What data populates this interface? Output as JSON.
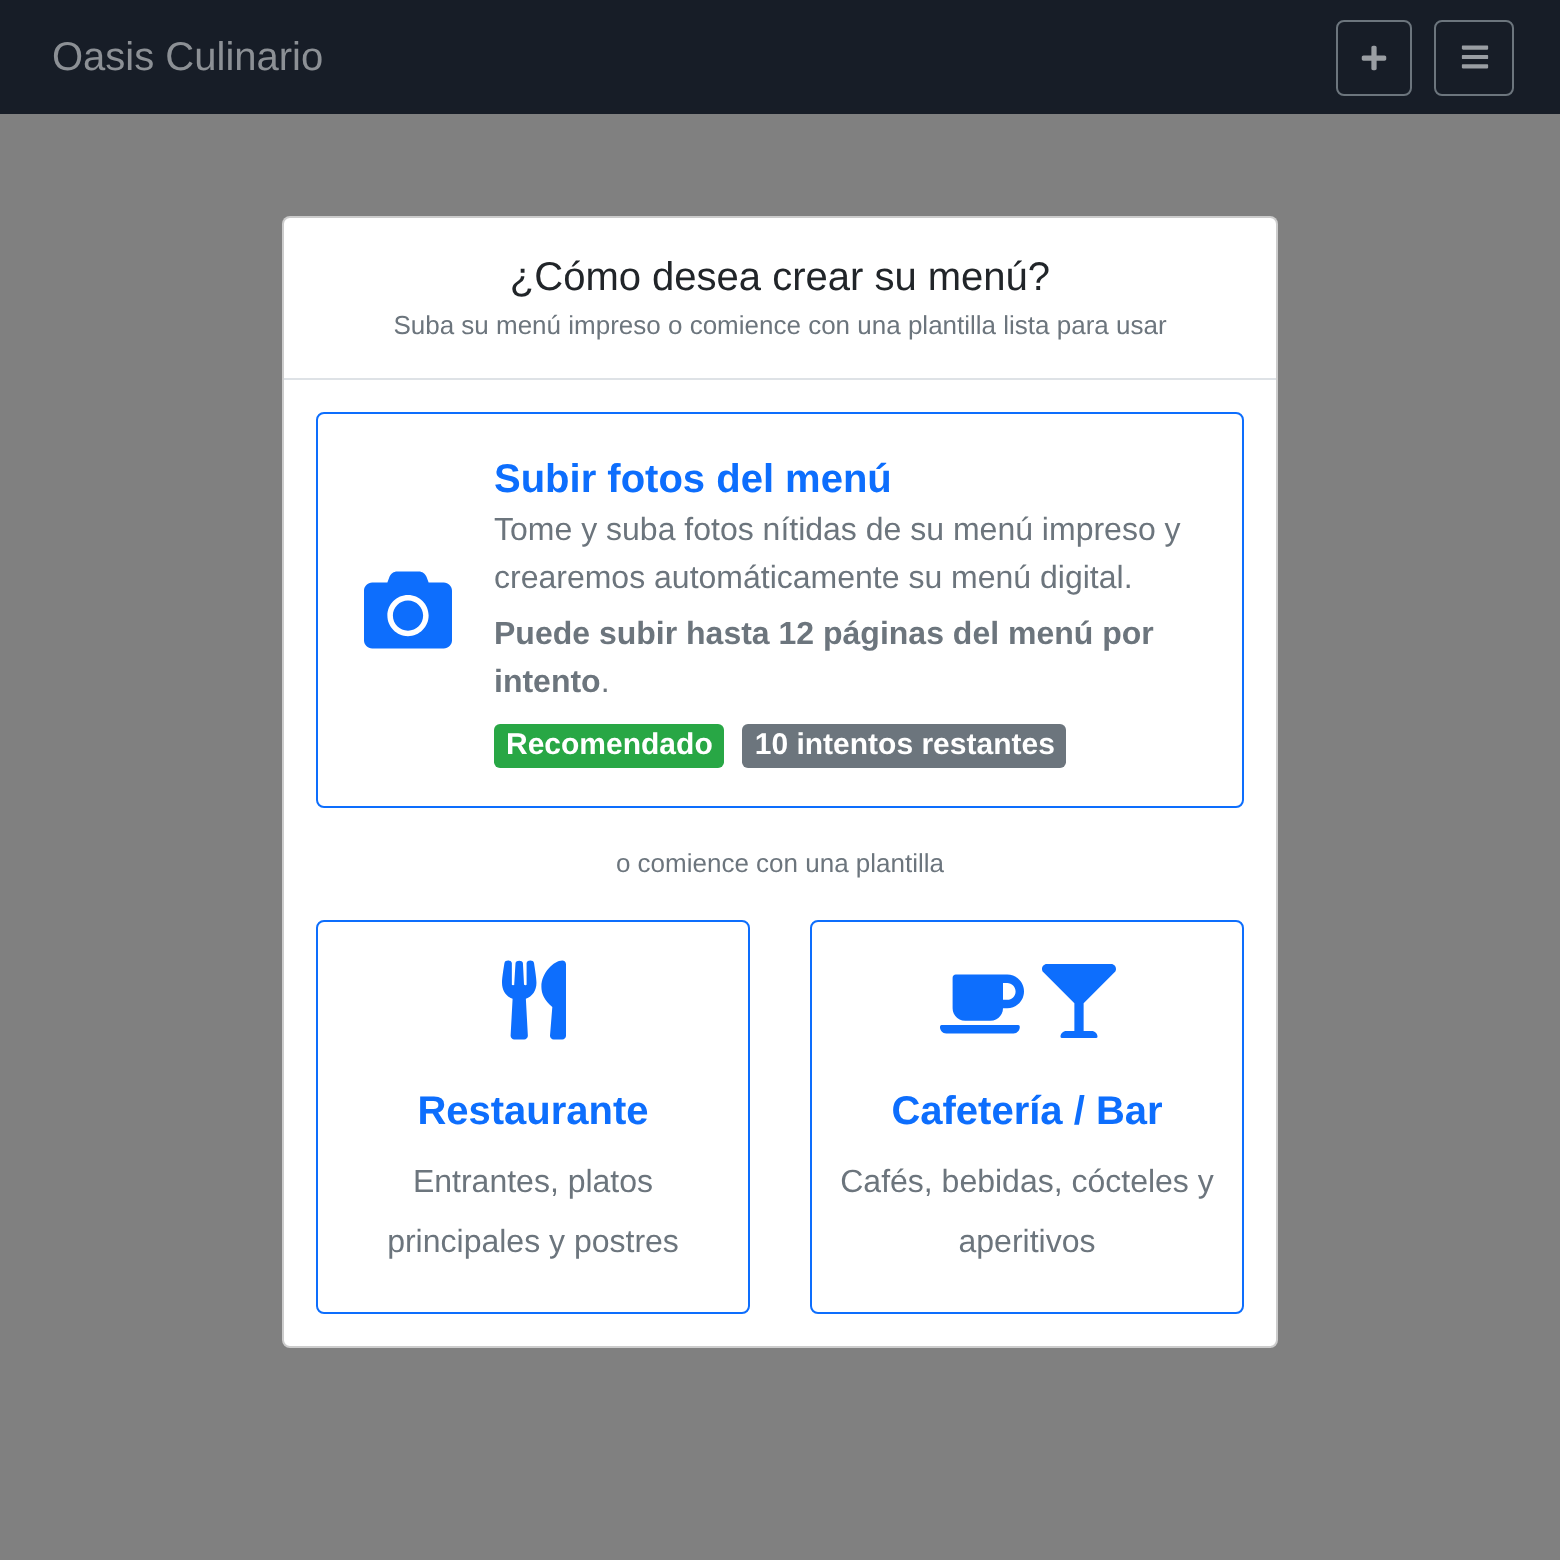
{
  "navbar": {
    "brand": "Oasis Culinario"
  },
  "dialog": {
    "title": "¿Cómo desea crear su menú?",
    "subtitle": "Suba su menú impreso o comience con una plantilla lista para usar",
    "upload_option": {
      "title": "Subir fotos del menú",
      "description": "Tome y suba fotos nítidas de su menú impreso y crearemos automáticamente su menú digital.",
      "note": "**Puede subir hasta 12 páginas del menú por intento**.",
      "badges": [
        {
          "label": "Recomendado",
          "color": "#28a745"
        },
        {
          "label": "10 intentos restantes",
          "color": "#6c757d"
        }
      ]
    },
    "divider_text": "o comience con una plantilla",
    "templates": [
      {
        "kind": "restaurant",
        "title": "Restaurante",
        "description": "Entrantes, platos principales y postres"
      },
      {
        "kind": "cafe_bar",
        "title": "Cafetería / Bar",
        "description": "Cafés, bebidas, cócteles y aperitivos"
      }
    ]
  }
}
